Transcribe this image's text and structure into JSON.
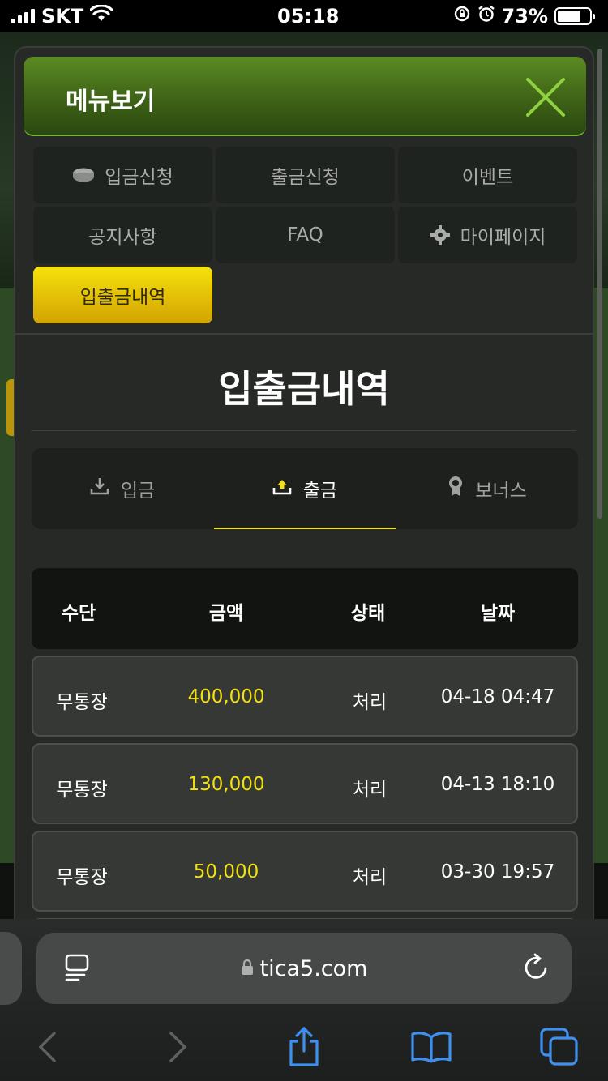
{
  "status_bar": {
    "carrier": "SKT",
    "time": "05:18",
    "battery": "73%"
  },
  "menu": {
    "title": "메뉴보기",
    "items": [
      {
        "label": "입금신청",
        "icon": "coin-icon"
      },
      {
        "label": "출금신청"
      },
      {
        "label": "이벤트"
      },
      {
        "label": "공지사항"
      },
      {
        "label": "FAQ"
      },
      {
        "label": "마이페이지",
        "icon": "gear-icon"
      },
      {
        "label": "입출금내역",
        "active": true
      }
    ]
  },
  "page": {
    "title": "입출금내역"
  },
  "tabs": [
    {
      "label": "입금",
      "icon": "download-icon"
    },
    {
      "label": "출금",
      "icon": "upload-icon",
      "active": true
    },
    {
      "label": "보너스",
      "icon": "award-icon"
    }
  ],
  "table": {
    "headers": [
      "수단",
      "금액",
      "상태",
      "날짜"
    ],
    "rows": [
      [
        "무통장",
        "400,000",
        "처리",
        "04-18 04:47"
      ],
      [
        "무통장",
        "130,000",
        "처리",
        "04-13 18:10"
      ],
      [
        "무통장",
        "50,000",
        "처리",
        "03-30 19:57"
      ]
    ]
  },
  "browser": {
    "url": "tica5.com"
  },
  "colors": {
    "accent_yellow": "#f3e10e",
    "header_green": "#4a7a1c",
    "close_green": "#8fd03e"
  }
}
